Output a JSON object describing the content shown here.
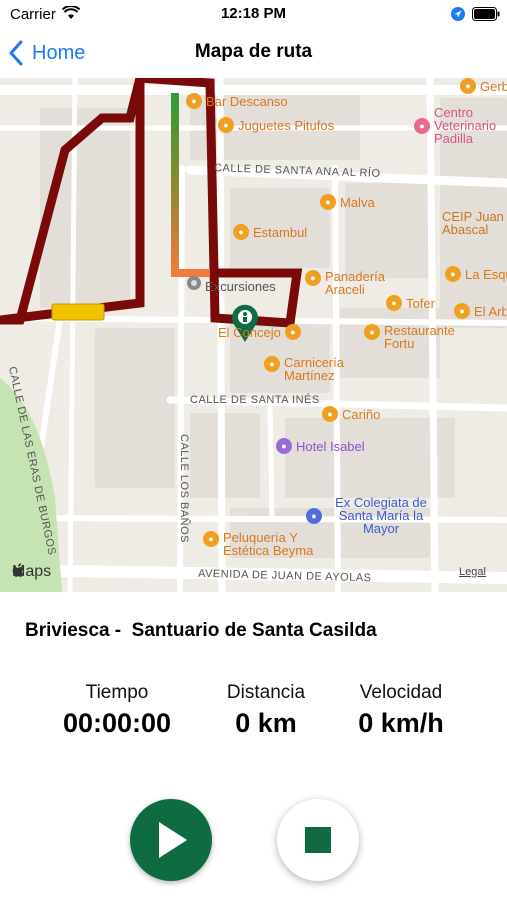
{
  "status_bar": {
    "carrier": "Carrier",
    "time": "12:18 PM"
  },
  "nav": {
    "back_label": "Home",
    "title": "Mapa de ruta"
  },
  "map": {
    "pois": [
      {
        "label": "Bar Descanso",
        "kind": "orange"
      },
      {
        "label": "Juguetes Pitufos",
        "kind": "orange"
      },
      {
        "label": "Malva",
        "kind": "orange"
      },
      {
        "label": "Estambul",
        "kind": "orange"
      },
      {
        "label": "Excursiones",
        "kind": "gray"
      },
      {
        "label": "Panadería Araceli",
        "kind": "orange"
      },
      {
        "label": "Tofer",
        "kind": "orange"
      },
      {
        "label": "El Arbol",
        "kind": "orange"
      },
      {
        "label": "Restaurante Fortu",
        "kind": "orange"
      },
      {
        "label": "El Concejo",
        "kind": "orange"
      },
      {
        "label": "Carnicería Martínez",
        "kind": "orange"
      },
      {
        "label": "Cariño",
        "kind": "orange"
      },
      {
        "label": "Hotel Isabel",
        "kind": "purple"
      },
      {
        "label": "Ex Colegiata de Santa María la Mayor",
        "kind": "blue"
      },
      {
        "label": "Peluquería Y Estética Beyma",
        "kind": "orange"
      },
      {
        "label": "Centro Veterinario Padilla",
        "kind": "pink"
      },
      {
        "label": "CEIP Juan Abascal",
        "kind": "orange"
      },
      {
        "label": "La Esquina",
        "kind": "orange"
      },
      {
        "label": "Gerbo",
        "kind": "orange"
      }
    ],
    "streets": {
      "santa_ana": "CALLE DE SANTA ANA AL RÍO",
      "santa_ines": "CALLE DE SANTA INÉS",
      "eras_burgos": "CALLE DE LAS ERAS DE BURGOS",
      "los_banos": "CALLE LOS BAÑOS",
      "juan_ayolas": "AVENIDA DE JUAN DE AYOLAS"
    },
    "brand": "Maps",
    "legal": "Legal",
    "route_color": "#7a0a0a",
    "route_start_color": "#3a9a3a",
    "marker_color": "#0f6b42"
  },
  "route": {
    "name": "Briviesca -  Santuario de Santa Casilda"
  },
  "stats": {
    "time": {
      "label": "Tiempo",
      "value": "00:00:00"
    },
    "distance": {
      "label": "Distancia",
      "value": "0 km"
    },
    "speed": {
      "label": "Velocidad",
      "value": "0 km/h"
    }
  },
  "controls": {
    "play_icon": "play-icon",
    "stop_icon": "stop-icon",
    "accent": "#0f6b42"
  }
}
